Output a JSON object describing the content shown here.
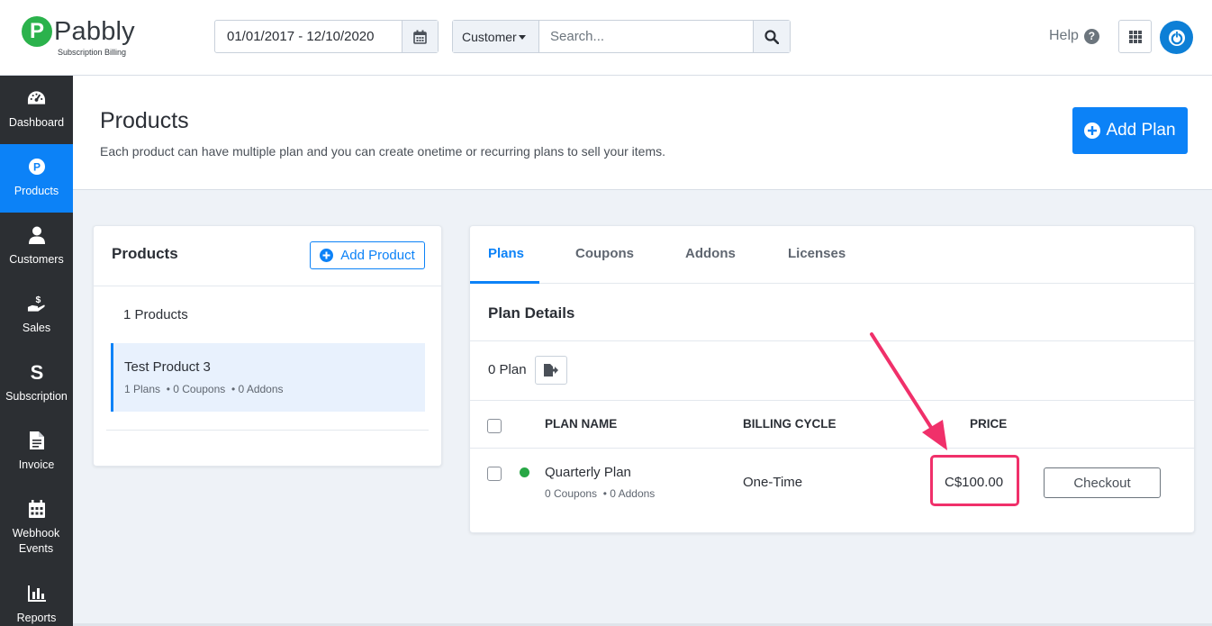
{
  "brand": {
    "name": "Pabbly",
    "subtitle": "Subscription Billing",
    "mark": "P",
    "color": "#2bb24c"
  },
  "topbar": {
    "date_range": "01/01/2017 - 12/10/2020",
    "search_dropdown": "Customer",
    "search_placeholder": "Search...",
    "help_label": "Help",
    "help_icon_glyph": "?"
  },
  "sidebar": {
    "items": [
      {
        "label": "Dashboard",
        "icon": "dashboard-icon",
        "active": false
      },
      {
        "label": "Products",
        "icon": "products-icon",
        "active": true
      },
      {
        "label": "Customers",
        "icon": "user-icon",
        "active": false
      },
      {
        "label": "Sales",
        "icon": "sales-icon",
        "active": false
      },
      {
        "label": "Subscription",
        "icon": "subscription-icon",
        "active": false
      },
      {
        "label": "Invoice",
        "icon": "invoice-icon",
        "active": false
      },
      {
        "label": "Webhook Events",
        "icon": "calendar-icon",
        "active": false
      },
      {
        "label": "Reports",
        "icon": "reports-icon",
        "active": false
      }
    ]
  },
  "header": {
    "title": "Products",
    "subtitle": "Each product can have multiple plan and you can create onetime or recurring plans to sell your items.",
    "add_plan_label": "Add Plan"
  },
  "products_panel": {
    "title": "Products",
    "add_product_label": "Add Product",
    "count_label": "1 Products",
    "items": [
      {
        "name": "Test Product 3",
        "meta": "1 Plans  • 0 Coupons  • 0 Addons"
      }
    ]
  },
  "plans_panel": {
    "tabs": [
      {
        "label": "Plans",
        "active": true
      },
      {
        "label": "Coupons",
        "active": false
      },
      {
        "label": "Addons",
        "active": false
      },
      {
        "label": "Licenses",
        "active": false
      }
    ],
    "section_title": "Plan Details",
    "plan_count": "0 Plan",
    "columns": {
      "name": "PLAN NAME",
      "cycle": "BILLING CYCLE",
      "price": "PRICE"
    },
    "rows": [
      {
        "name": "Quarterly Plan",
        "meta": "0 Coupons  • 0 Addons",
        "cycle": "One-Time",
        "price": "C$100.00",
        "action": "Checkout",
        "status_color": "#28a745"
      }
    ]
  },
  "colors": {
    "accent": "#0c82f7",
    "sidebar_bg": "#2c2f33",
    "annotation": "#f0306a"
  }
}
